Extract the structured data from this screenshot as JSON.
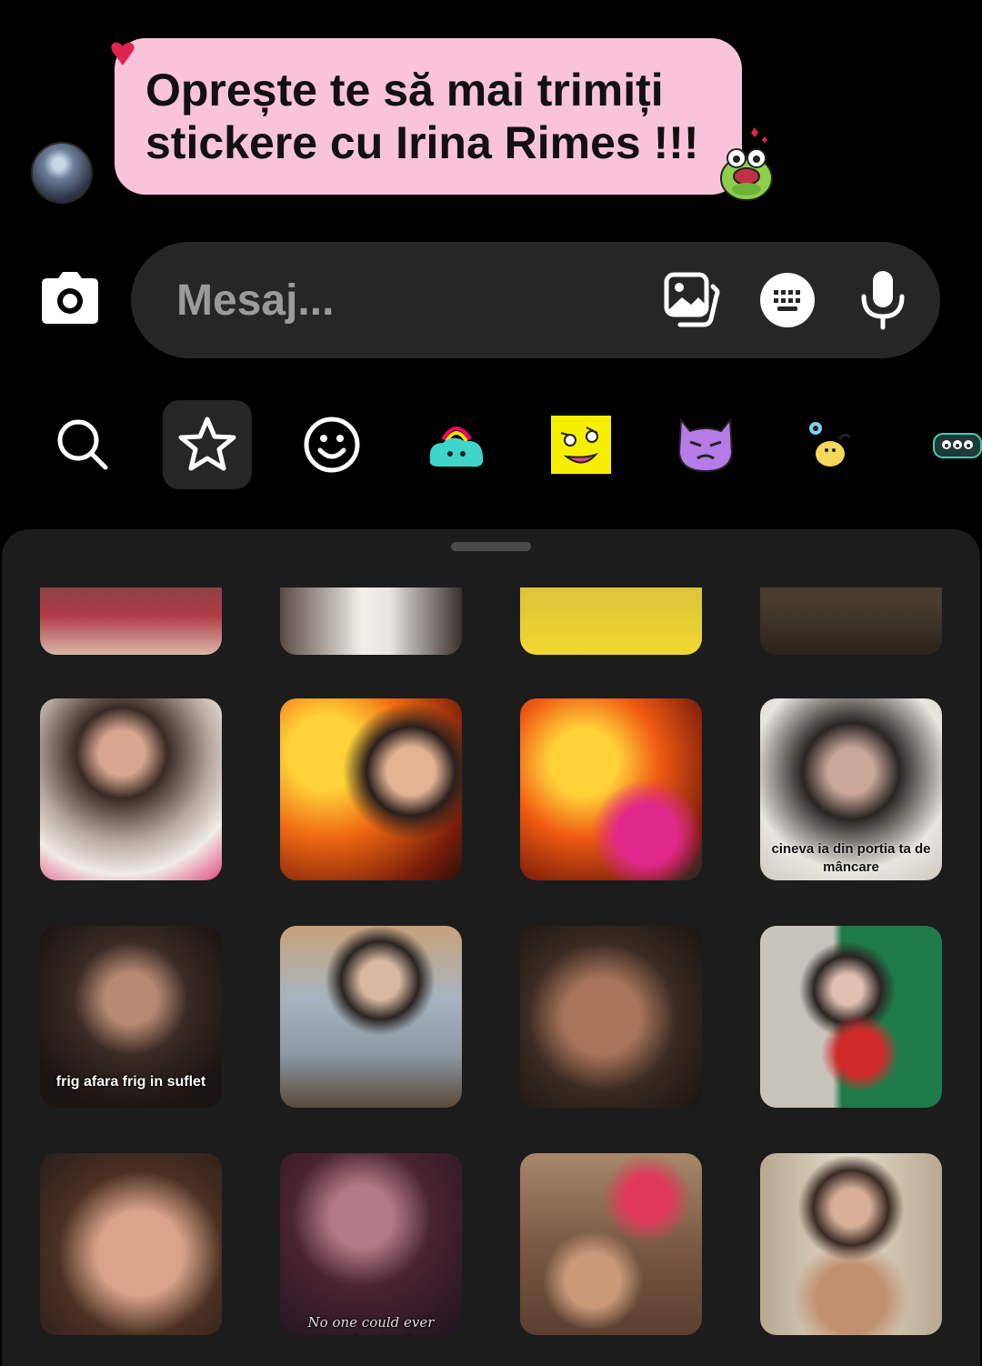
{
  "message": {
    "text_line1": "Oprește te să mai trimiți",
    "text_line2": "stickere cu Irina Rimes !!!",
    "reaction_icon": "heart-icon"
  },
  "composer": {
    "placeholder": "Mesaj...",
    "icons": [
      "camera-icon",
      "gallery-icon",
      "sticker-keyboard-icon",
      "microphone-icon"
    ]
  },
  "sticker_tabs": [
    {
      "name": "search",
      "icon": "search-icon"
    },
    {
      "name": "favorites",
      "icon": "star-icon",
      "active": true
    },
    {
      "name": "emoji",
      "icon": "smiley-icon"
    },
    {
      "name": "pack-1",
      "icon": "rainbow-blob-icon"
    },
    {
      "name": "pack-2",
      "icon": "yellow-face-icon"
    },
    {
      "name": "pack-3",
      "icon": "purple-cat-icon"
    },
    {
      "name": "pack-4",
      "icon": "duck-icon"
    },
    {
      "name": "pack-5",
      "icon": "dark-creature-icon"
    }
  ],
  "stickers": [
    {
      "caption": ""
    },
    {
      "caption": ""
    },
    {
      "caption": ""
    },
    {
      "caption": ""
    },
    {
      "caption": ""
    },
    {
      "caption": ""
    },
    {
      "caption": ""
    },
    {
      "caption": "cineva ia din portia ta de mâncare"
    },
    {
      "caption": "frig afara frig in suflet"
    },
    {
      "caption": ""
    },
    {
      "caption": ""
    },
    {
      "caption": ""
    },
    {
      "caption": ""
    },
    {
      "caption": "No one could ever understand"
    },
    {
      "caption": ""
    },
    {
      "caption": ""
    }
  ],
  "colors": {
    "bubble": "#f9c4da",
    "background": "#000000",
    "panel": "#1c1c1c",
    "field": "#262626"
  }
}
